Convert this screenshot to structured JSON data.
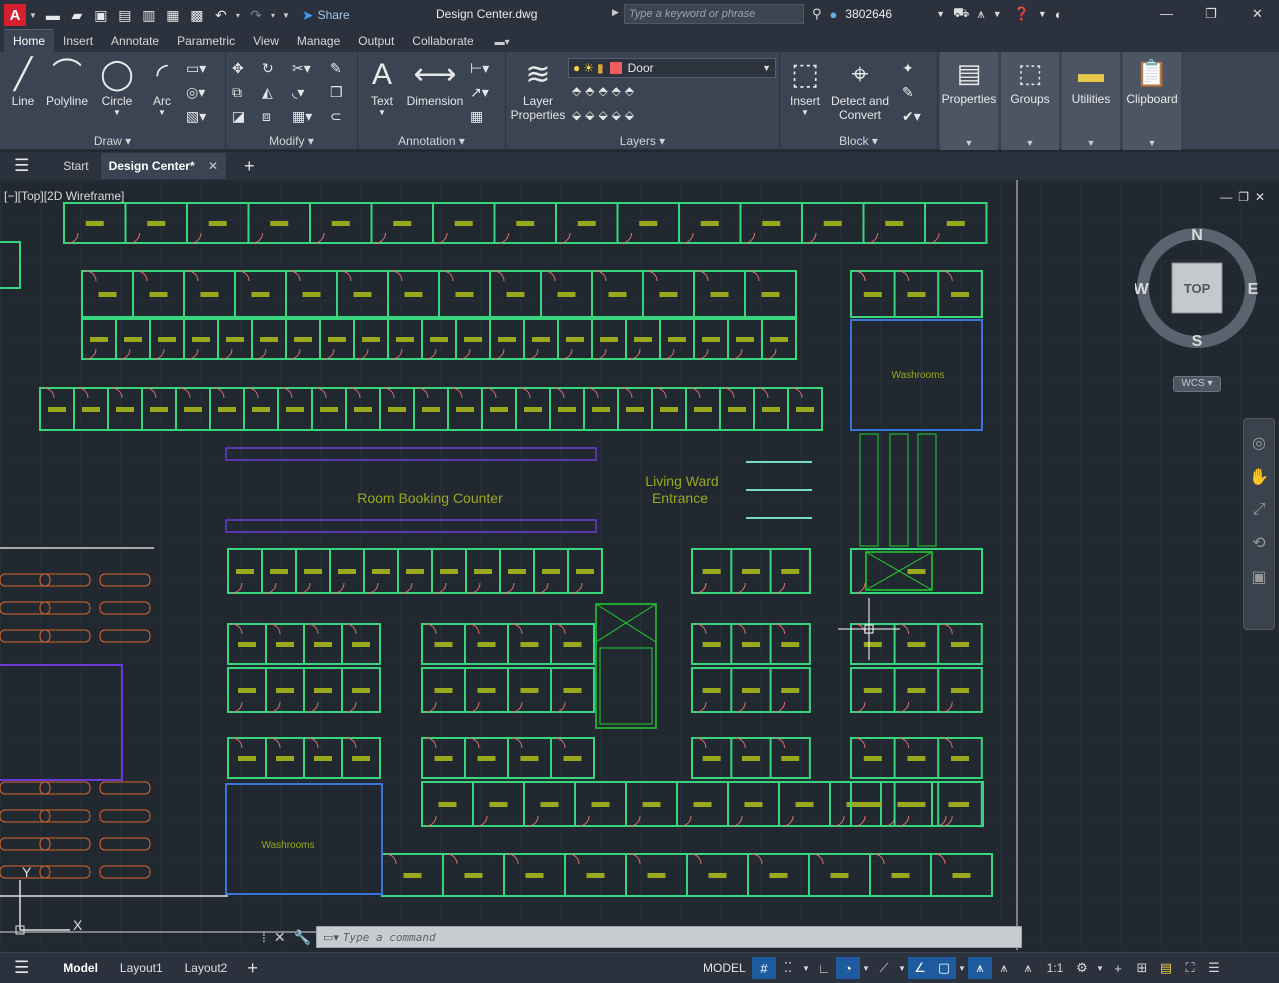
{
  "app": {
    "logo_letter": "A",
    "title": "Design Center.dwg",
    "share_label": "Share",
    "search_placeholder": "Type a keyword or phrase",
    "user_id": "3802646"
  },
  "ribbon_tabs": [
    "Home",
    "Insert",
    "Annotate",
    "Parametric",
    "View",
    "Manage",
    "Output",
    "Collaborate"
  ],
  "ribbon": {
    "draw": {
      "title": "Draw",
      "line": "Line",
      "polyline": "Polyline",
      "circle": "Circle",
      "arc": "Arc"
    },
    "modify": {
      "title": "Modify"
    },
    "annotation": {
      "title": "Annotation",
      "text": "Text",
      "dimension": "Dimension"
    },
    "layers": {
      "title": "Layers",
      "layer_properties_1": "Layer",
      "layer_properties_2": "Properties",
      "current_layer": "Door",
      "current_layer_color": "#f06060"
    },
    "block": {
      "title": "Block",
      "insert": "Insert",
      "detect_1": "Detect and",
      "detect_2": "Convert"
    },
    "properties": "Properties",
    "groups": "Groups",
    "utilities": "Utilities",
    "clipboard": "Clipboard"
  },
  "file_tabs": {
    "start": "Start",
    "active": "Design Center*"
  },
  "viewport": {
    "label": "[−][Top][2D Wireframe]",
    "room_booking": "Room Booking Counter",
    "living_ward_1": "Living Ward",
    "living_ward_2": "Entrance",
    "washrooms": "Washrooms",
    "ucs_y": "Y",
    "ucs_x": "X"
  },
  "viewcube": {
    "n": "N",
    "s": "S",
    "e": "E",
    "w": "W",
    "face": "TOP",
    "wcs": "WCS"
  },
  "command": {
    "placeholder": "Type a command"
  },
  "status": {
    "model_tab": "Model",
    "layout1": "Layout1",
    "layout2": "Layout2",
    "model_label": "MODEL",
    "scale": "1:1"
  },
  "colors": {
    "wall": "#38d67c",
    "door": "#e07070",
    "furniture": "#9aa81c",
    "purple": "#6a3ad8",
    "blue": "#3a74d8",
    "orange": "#d8682a"
  }
}
